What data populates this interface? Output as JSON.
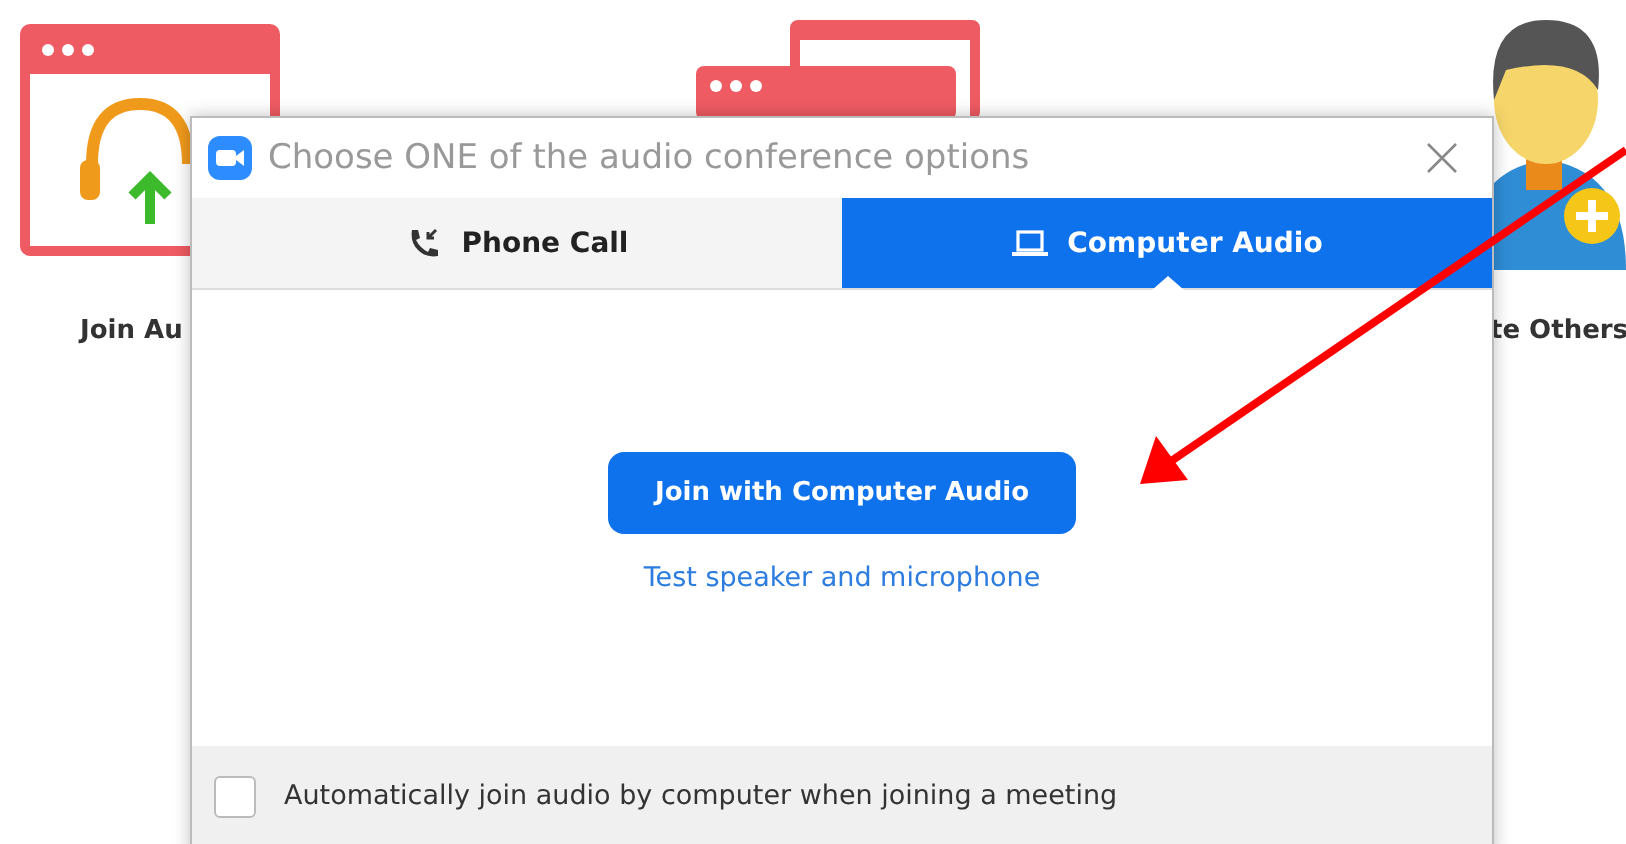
{
  "background": {
    "labels": [
      "Join Au",
      "te Others"
    ]
  },
  "dialog": {
    "title": "Choose ONE of the audio conference options",
    "tabs": [
      {
        "label": "Phone Call",
        "kind": "phone",
        "selected": false
      },
      {
        "label": "Computer Audio",
        "kind": "laptop",
        "selected": true
      }
    ],
    "join_button": "Join with Computer Audio",
    "test_link": "Test speaker and microphone",
    "auto_join": {
      "label": "Automatically join audio by computer when joining a meeting",
      "checked": false
    }
  }
}
